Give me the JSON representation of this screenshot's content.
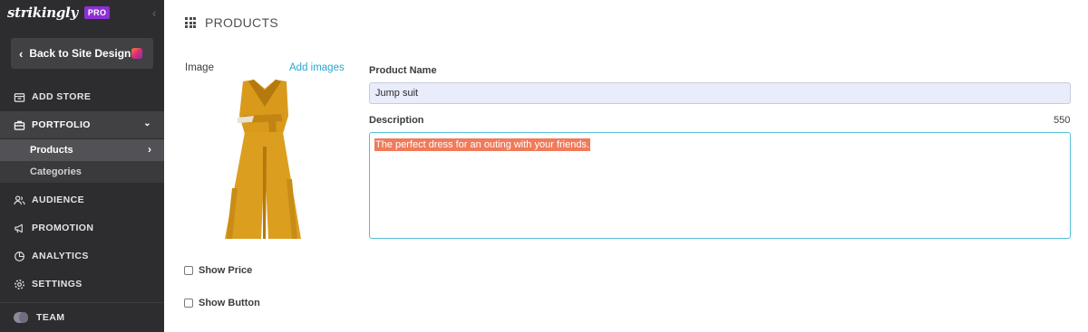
{
  "brand": {
    "name": "strikingly",
    "badge": "PRO"
  },
  "sidebar": {
    "back_label": "Back to Site Design",
    "items": [
      {
        "label": "ADD STORE",
        "icon": "store-icon"
      },
      {
        "label": "PORTFOLIO",
        "icon": "briefcase-icon"
      },
      {
        "label": "AUDIENCE",
        "icon": "audience-icon"
      },
      {
        "label": "PROMOTION",
        "icon": "megaphone-icon"
      },
      {
        "label": "ANALYTICS",
        "icon": "pie-chart-icon"
      },
      {
        "label": "SETTINGS",
        "icon": "gear-icon"
      },
      {
        "label": "TEAM",
        "icon": "team-avatar-icon"
      }
    ],
    "sub_items": [
      {
        "label": "Products"
      },
      {
        "label": "Categories"
      }
    ]
  },
  "page": {
    "title": "PRODUCTS"
  },
  "image_panel": {
    "label": "Image",
    "add_link": "Add images"
  },
  "options": {
    "show_price": "Show Price",
    "show_button": "Show Button"
  },
  "form": {
    "product_name_label": "Product Name",
    "product_name_value": "Jump suit",
    "description_label": "Description",
    "description_count": "550",
    "description_value": "The perfect dress for an outing with your friends."
  },
  "colors": {
    "sidebar_bg": "#2d2d2f",
    "accent_link": "#2aa5d0",
    "selection": "#f07a59",
    "pro_badge": "#8d2fd6"
  }
}
